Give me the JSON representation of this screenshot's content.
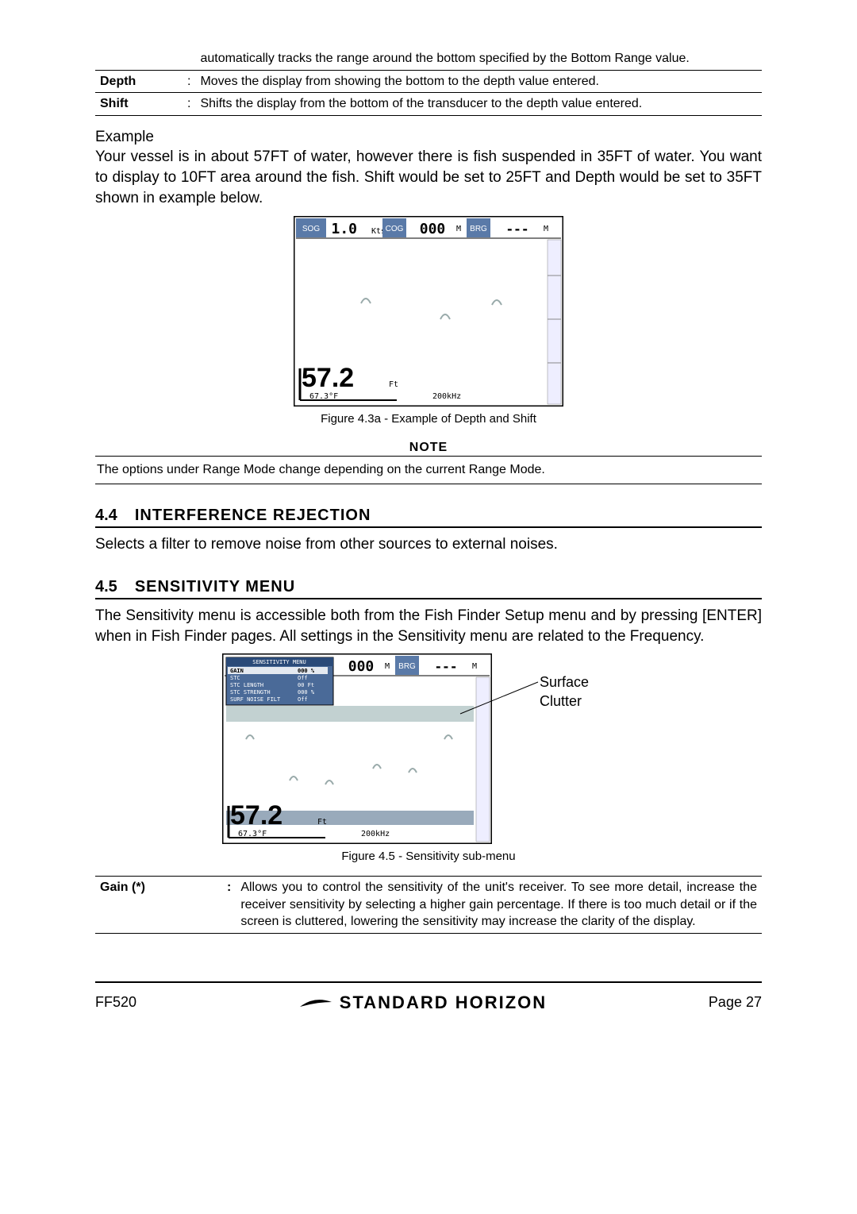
{
  "defs": {
    "prev_desc": "automatically tracks the range around the bottom specified by the Bottom Range value.",
    "depth_term": "Depth",
    "depth_desc": "Moves the display from showing the bottom to the depth value entered.",
    "shift_term": "Shift",
    "shift_desc": "Shifts the display from the bottom of the transducer to the depth value entered."
  },
  "example": {
    "label": "Example",
    "text": "Your vessel is in about 57FT of water, however there is fish suspended in 35FT of water. You want to display to 10FT area around the fish. Shift would be set to 25FT and Depth would be set to 35FT shown in example below."
  },
  "fig1": {
    "sog_label": "SOG",
    "sog_value": "1.0",
    "sog_unit": "Kts",
    "cog_label": "COG",
    "cog_value": "000",
    "cog_unit": "M",
    "brg_label": "BRG",
    "brg_value": "---",
    "brg_unit": "M",
    "depth": "57.2",
    "depth_unit": "Ft",
    "temp": "67.3°F",
    "freq": "200kHz",
    "caption": "Figure 4.3a -  Example of Depth and Shift"
  },
  "note": {
    "title": "NOTE",
    "text": "The options  under Range Mode change depending on the current Range Mode."
  },
  "sec44": {
    "num": "4.4",
    "title": "INTERFERENCE REJECTION",
    "body": "Selects a filter to remove noise from other sources to external noises."
  },
  "sec45": {
    "num": "4.5",
    "title": "SENSITIVITY MENU",
    "body": "The Sensitivity menu is accessible both from the Fish Finder Setup menu and by pressing [ENTER] when in Fish Finder pages. All settings in the Sensitivity menu are related to the Frequency."
  },
  "fig2": {
    "menu_title": "SENSITIVITY MENU",
    "menu_rows": [
      {
        "k": "GAIN",
        "v": "000 %"
      },
      {
        "k": "STC",
        "v": "Off"
      },
      {
        "k": "STC LENGTH",
        "v": "00 Ft"
      },
      {
        "k": "STC STRENGTH",
        "v": "000 %"
      },
      {
        "k": "SURF NOISE FILT",
        "v": "Off"
      }
    ],
    "cog_value": "000",
    "cog_unit": "M",
    "brg_label": "BRG",
    "brg_value": "---",
    "brg_unit": "M",
    "depth": "57.2",
    "depth_unit": "Ft",
    "temp": "67.3°F",
    "freq": "200kHz",
    "callout": "Surface Clutter",
    "caption": "Figure 4.5 -  Sensitivity sub-menu"
  },
  "gain_row": {
    "term": "Gain (*)",
    "desc": "Allows you to control the sensitivity of the unit's receiver. To see more detail, increase the receiver sensitivity by selecting a higher gain percentage. If there is too much detail or if the screen is cluttered, lowering the sensitivity may increase the clarity of the display."
  },
  "footer": {
    "left": "FF520",
    "brand": "STANDARD HORIZON",
    "right": "Page 27"
  }
}
